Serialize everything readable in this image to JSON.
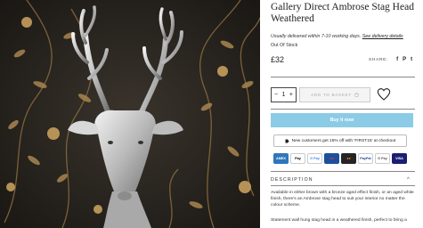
{
  "product": {
    "title": "Gallery Direct Ambrose Stag Head Weathered",
    "image_alt": "Silver stag head wall decoration on dark gold floral wallpaper"
  },
  "delivery": {
    "text": "Usually delivered within 7-10 working days.",
    "link": "See delivery details"
  },
  "stock": "Out Of Stock",
  "price": "£32",
  "share": {
    "label": "SHARE:",
    "icons": [
      "facebook-icon",
      "pinterest-icon",
      "twitter-icon"
    ],
    "glyphs": [
      "f",
      "P",
      "t"
    ]
  },
  "quantity": {
    "minus": "−",
    "value": "1",
    "plus": "+"
  },
  "basket_label": "ADD TO BASKET",
  "buy_now": "Buy it now",
  "promo": "New customers get 15% off with 'FIRST15' at checkout",
  "payments": [
    {
      "name": "amex",
      "label": "AMEX",
      "color": "#2e77bb"
    },
    {
      "name": "apple-pay",
      "label": "Pay",
      "color": "#000000"
    },
    {
      "name": "google-pay",
      "label": "G Pay",
      "color": "#ffffff"
    },
    {
      "name": "maestro",
      "label": "●●",
      "color": "#1d4f9c"
    },
    {
      "name": "mastercard",
      "label": "●●",
      "color": "#252525"
    },
    {
      "name": "paypal",
      "label": "PayPal",
      "color": "#ffffff"
    },
    {
      "name": "gpay",
      "label": "G Pay",
      "color": "#ffffff"
    },
    {
      "name": "visa",
      "label": "VISA",
      "color": "#1a1f71"
    }
  ],
  "description": {
    "heading": "DESCRIPTION",
    "paragraph1": "Available in either brown with a bronze aged effect finish, or an aged white finish, there's an Ambrose stag head to suit your interior no matter the colour scheme.",
    "paragraph2": "Statement wall hung stag head in a weathered finish, perfect to bring a"
  },
  "colors": {
    "accent": "#8ccbe6",
    "wallpaper": "#2a2622",
    "gold": "#b08a52",
    "silver": "#c9c9c9"
  }
}
